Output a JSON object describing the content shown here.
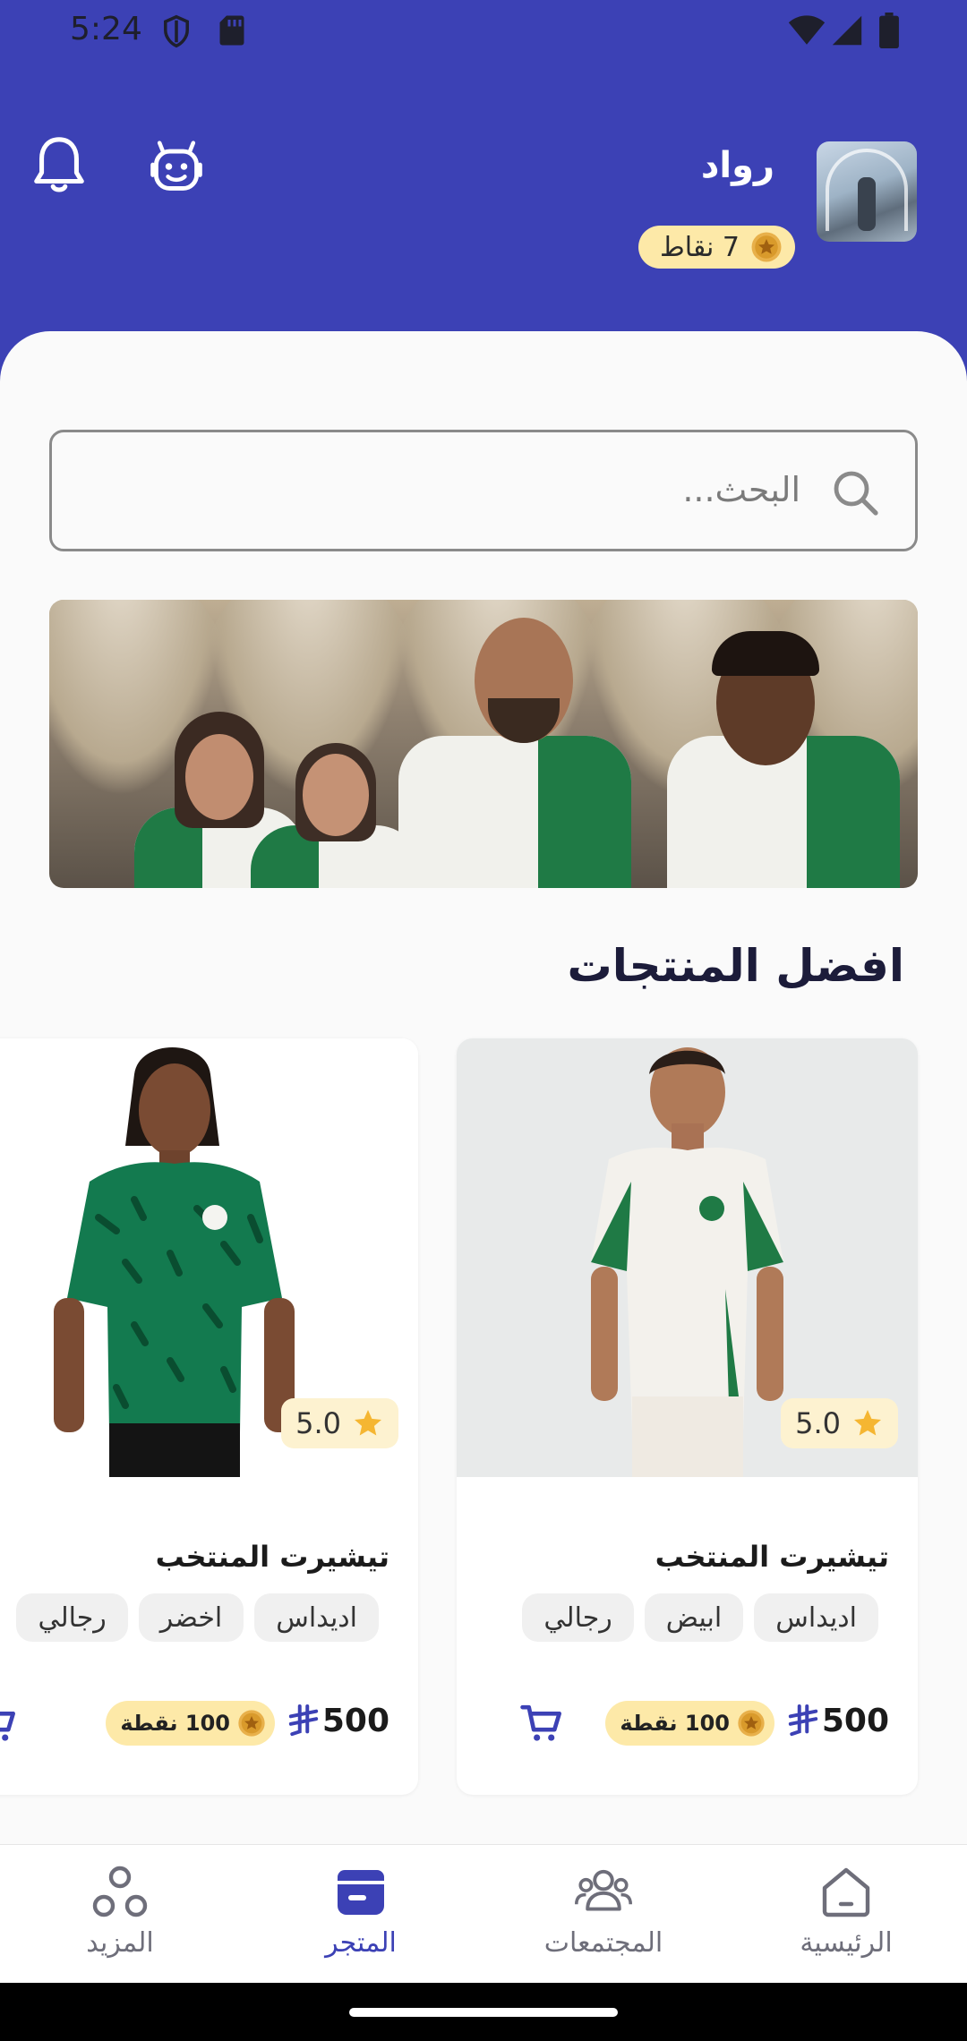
{
  "status_bar": {
    "time": "5:24"
  },
  "header": {
    "user_name": "رواد",
    "points_label": "7 نقاط",
    "bg_color": "#3c41b5",
    "accent_color": "#fde9a8"
  },
  "search": {
    "placeholder": "البحث...",
    "value": ""
  },
  "section": {
    "title": "افضل المنتجات"
  },
  "products": [
    {
      "name": "تيشيرت المنتخب",
      "rating": "5.0",
      "tags": [
        "اديداس",
        "ابيض",
        "رجالي"
      ],
      "price": "500",
      "points": "100 نقطة"
    },
    {
      "name": "تيشيرت المنتخب",
      "rating": "5.0",
      "tags": [
        "اديداس",
        "اخضر",
        "رجالي"
      ],
      "price": "500",
      "points": "100 نقطة"
    }
  ],
  "nav": {
    "home": "الرئيسية",
    "communities": "المجتمعات",
    "store": "المتجر",
    "more": "المزيد",
    "active": "store"
  }
}
